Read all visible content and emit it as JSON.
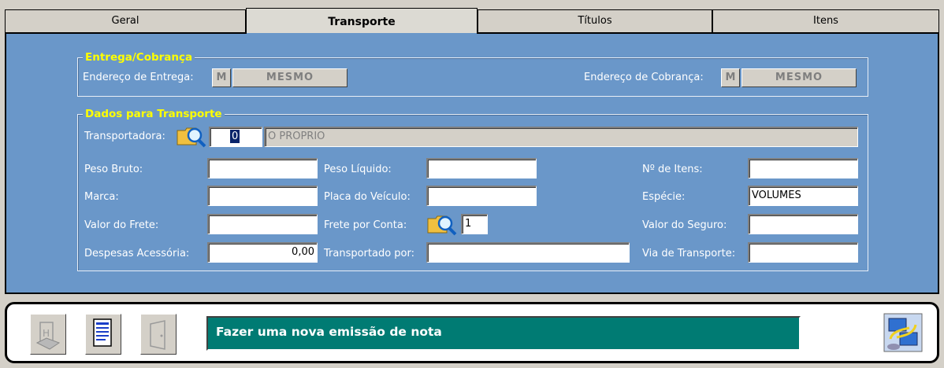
{
  "tabs": [
    {
      "label": "Geral"
    },
    {
      "label": "Transporte",
      "active": true
    },
    {
      "label": "Títulos"
    },
    {
      "label": "Itens"
    }
  ],
  "entrega": {
    "legend": "Entrega/Cobrança",
    "endereco_entrega_label": "Endereço de  Entrega:",
    "endereco_entrega_code": "M",
    "endereco_entrega_value": "MESMO",
    "endereco_cobranca_label": "Endereço de Cobrança:",
    "endereco_cobranca_code": "M",
    "endereco_cobranca_value": "MESMO"
  },
  "transporte": {
    "legend": "Dados para Transporte",
    "transportadora_label": "Transportadora:",
    "transportadora_code": "0",
    "transportadora_name": "O PROPRIO",
    "peso_bruto_label": "Peso Bruto:",
    "peso_bruto_value": "",
    "peso_liquido_label": "Peso Líquido:",
    "peso_liquido_value": "",
    "num_itens_label": "Nº de Itens:",
    "num_itens_value": "",
    "marca_label": "Marca:",
    "marca_value": "",
    "placa_label": "Placa do Veículo:",
    "placa_value": "",
    "especie_label": "Espécie:",
    "especie_value": "VOLUMES",
    "valor_frete_label": "Valor do Frete:",
    "valor_frete_value": "",
    "frete_conta_label": "Frete por Conta:",
    "frete_conta_value": "1",
    "valor_seguro_label": "Valor do Seguro:",
    "valor_seguro_value": "",
    "despesas_label": "Despesas Acessória:",
    "despesas_value": "0,00",
    "transportado_por_label": "Transportado por:",
    "transportado_por_value": "",
    "via_transporte_label": "Via de Transporte:",
    "via_transporte_value": ""
  },
  "bottom": {
    "status_text": "Fazer uma nova emissão de nota"
  },
  "colors": {
    "panel": "#6a97c9",
    "legend": "#ffff00",
    "status_bg": "#007b73"
  }
}
